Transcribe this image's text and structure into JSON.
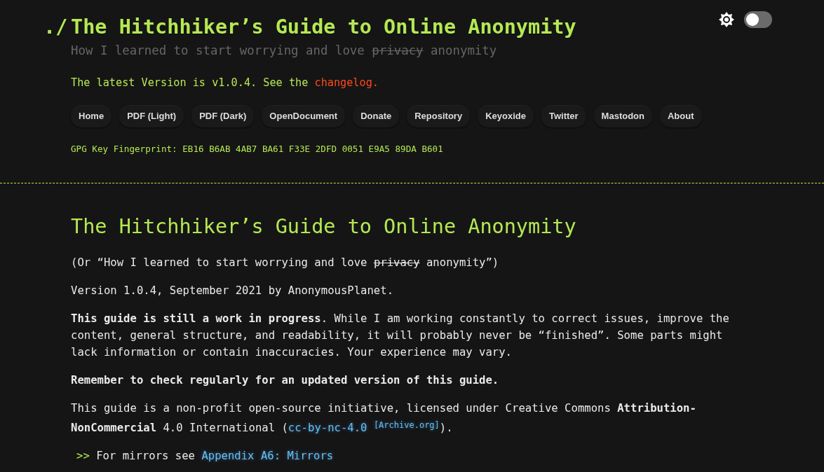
{
  "header": {
    "prompt": "./",
    "title": "The Hitchhiker’s Guide to Online Anonymity",
    "subtitle": {
      "before": "How I learned to start worrying and love",
      "struck": "privacy",
      "after": "anonymity"
    },
    "version_line": [
      {
        "kind": "text",
        "text": "The latest Version is v1.0.4. See the"
      },
      {
        "kind": "link",
        "text": "changelog."
      }
    ],
    "nav": [
      "Home",
      "PDF (Light)",
      "PDF (Dark)",
      "OpenDocument",
      "Donate",
      "Repository",
      "Keyoxide",
      "Twitter",
      "Mastodon",
      "About"
    ],
    "fingerprint": "GPG Key Fingerprint: EB16 B6AB 4AB7 BA61 F33E 2DFD 0051 E9A5 89DA B601",
    "theme_switch": {
      "on": false
    }
  },
  "content": {
    "title": "The Hitchhiker’s Guide to Online Anonymity",
    "paragraphs": [
      [
        {
          "kind": "text",
          "text": "(Or “How I learned to start worrying and love"
        },
        {
          "kind": "struck",
          "text": "privacy"
        },
        {
          "kind": "text",
          "text": "anonymity”)"
        }
      ],
      [
        {
          "kind": "text",
          "text": "Version 1.0.4, September 2021 by AnonymousPlanet."
        }
      ],
      [
        {
          "kind": "text",
          "text": "**This guide is still a work in progress**. While I am working constantly to correct issues, improve the content, general structure, and readability, it will probably never be “finished”. Some parts might lack information or contain inaccuracies. Your experience may vary."
        }
      ],
      [
        {
          "kind": "text",
          "text": "**Remember to check regularly for an updated version of this guide.**"
        }
      ],
      [
        {
          "kind": "text",
          "text": "This guide is a non-profit open-source initiative, licensed under Creative Commons **Attribution-NonCommercial** 4.0 International ("
        },
        {
          "kind": "link",
          "text": "cc-by-nc-4.0"
        },
        {
          "kind": "sup_link",
          "text": "[Archive.org]"
        },
        {
          "kind": "text",
          "text": ")."
        }
      ],
      [
        {
          "kind": "marker",
          "text": ">>"
        },
        {
          "kind": "text",
          "text": "For mirrors see"
        },
        {
          "kind": "link",
          "text": "Appendix A6: Mirrors"
        }
      ]
    ]
  }
}
